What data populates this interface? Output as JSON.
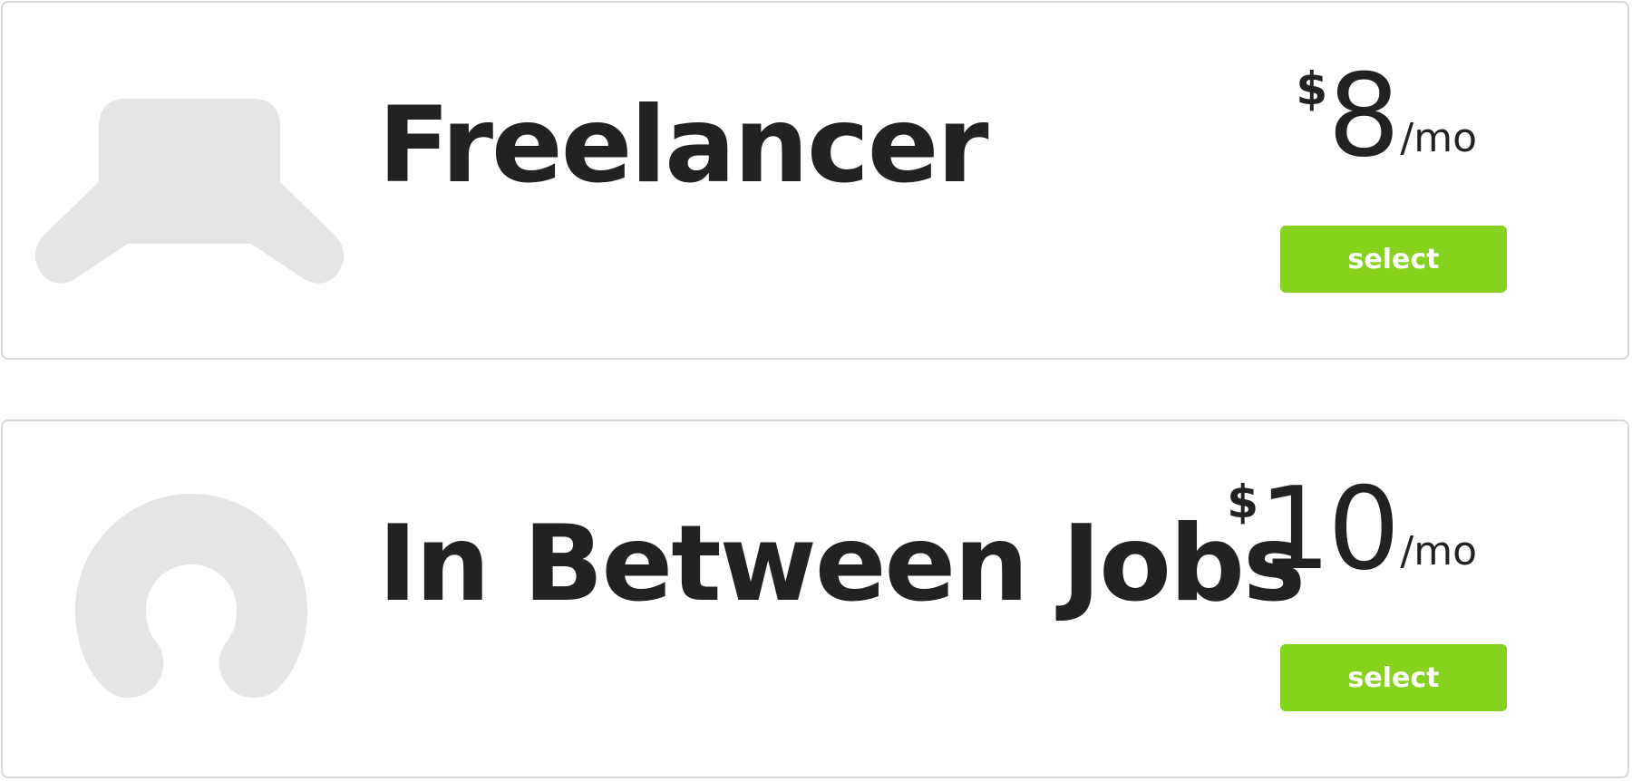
{
  "colors": {
    "accent": "#86d31e",
    "icon": "#e5e5e5",
    "text": "#222222",
    "border": "#d6d6d6"
  },
  "plans": [
    {
      "name": "Freelancer",
      "icon": "laptop-icon",
      "price": {
        "currency": "$",
        "amount": "8",
        "period": "/mo"
      },
      "button_label": "select"
    },
    {
      "name": "In Between Jobs",
      "icon": "neck-pillow-icon",
      "price": {
        "currency": "$",
        "amount": "10",
        "period": "/mo"
      },
      "button_label": "select"
    }
  ]
}
